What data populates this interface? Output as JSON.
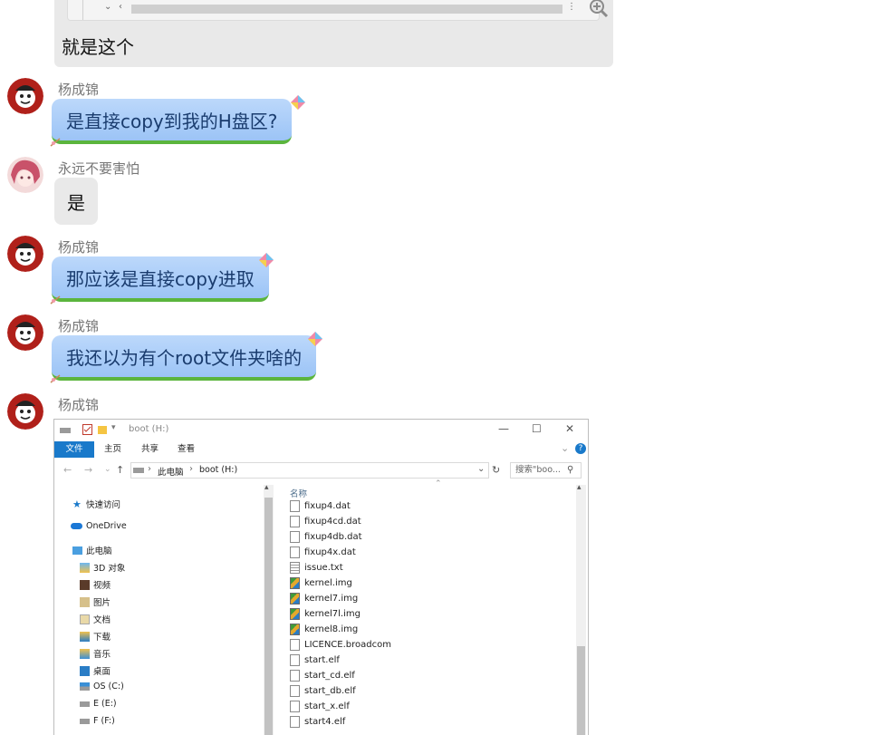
{
  "top_message": {
    "text": "就是这个"
  },
  "messages": [
    {
      "sender": "杨成锦",
      "text": "是直接copy到我的H盘区?",
      "style": "blue"
    },
    {
      "sender": "永远不要害怕",
      "text": "是",
      "style": "gray"
    },
    {
      "sender": "杨成锦",
      "text": "那应该是直接copy进取",
      "style": "blue"
    },
    {
      "sender": "杨成锦",
      "text": "我还以为有个root文件夹啥的",
      "style": "blue"
    },
    {
      "sender": "杨成锦",
      "text": "",
      "style": "image"
    }
  ],
  "explorer": {
    "title": "boot (H:)",
    "ribbon_tabs": [
      "文件",
      "主页",
      "共享",
      "查看"
    ],
    "path": [
      "此电脑",
      "boot (H:)"
    ],
    "search_placeholder": "搜索\"boo...",
    "nav_items": [
      "快速访问",
      "OneDrive",
      "此电脑",
      "3D 对象",
      "视频",
      "图片",
      "文档",
      "下载",
      "音乐",
      "桌面",
      "OS (C:)",
      "E (E:)",
      "F (F:)"
    ],
    "column_header": "名称",
    "files": [
      {
        "name": "fixup4.dat",
        "icon": "document-icon"
      },
      {
        "name": "fixup4cd.dat",
        "icon": "document-icon"
      },
      {
        "name": "fixup4db.dat",
        "icon": "document-icon"
      },
      {
        "name": "fixup4x.dat",
        "icon": "document-icon"
      },
      {
        "name": "issue.txt",
        "icon": "text-file-icon"
      },
      {
        "name": "kernel.img",
        "icon": "image-file-icon"
      },
      {
        "name": "kernel7.img",
        "icon": "image-file-icon"
      },
      {
        "name": "kernel7l.img",
        "icon": "image-file-icon"
      },
      {
        "name": "kernel8.img",
        "icon": "image-file-icon"
      },
      {
        "name": "LICENCE.broadcom",
        "icon": "document-icon"
      },
      {
        "name": "start.elf",
        "icon": "document-icon"
      },
      {
        "name": "start_cd.elf",
        "icon": "document-icon"
      },
      {
        "name": "start_db.elf",
        "icon": "document-icon"
      },
      {
        "name": "start_x.elf",
        "icon": "document-icon"
      },
      {
        "name": "start4.elf",
        "icon": "document-icon"
      }
    ]
  },
  "colors": {
    "bubble_blue": "#a9cdf8",
    "bubble_text": "#1a3c6e",
    "bubble_border": "#5bb53d",
    "bubble_gray": "#e9e9e9",
    "ribbon_accent": "#1979ca"
  }
}
